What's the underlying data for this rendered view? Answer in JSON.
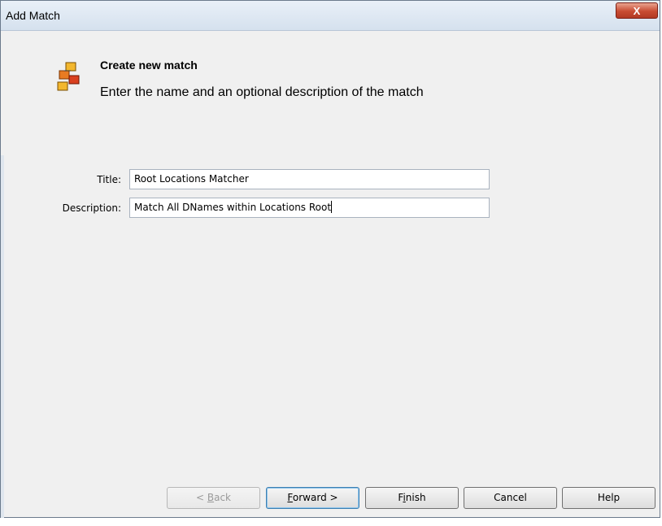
{
  "window": {
    "title": "Add Match",
    "close_glyph": "X"
  },
  "header": {
    "icon": "match-icon",
    "title": "Create new match",
    "subtitle": "Enter the name and an optional description of the match"
  },
  "form": {
    "title_label": "Title:",
    "title_value": "Root Locations Matcher",
    "description_label": "Description:",
    "description_value": "Match All DNames within Locations Root"
  },
  "buttons": {
    "back_prefix": "< ",
    "back_mnemonic": "B",
    "back_rest": "ack",
    "forward_mnemonic": "F",
    "forward_rest": "orward >",
    "finish_pre": "F",
    "finish_mnemonic": "i",
    "finish_rest": "nish",
    "cancel_label": "Cancel",
    "help_label": "Help"
  },
  "colors": {
    "dialog_bg": "#f0f0f0",
    "close_button": "#c84b32",
    "default_button_border": "#3c7fb1"
  }
}
